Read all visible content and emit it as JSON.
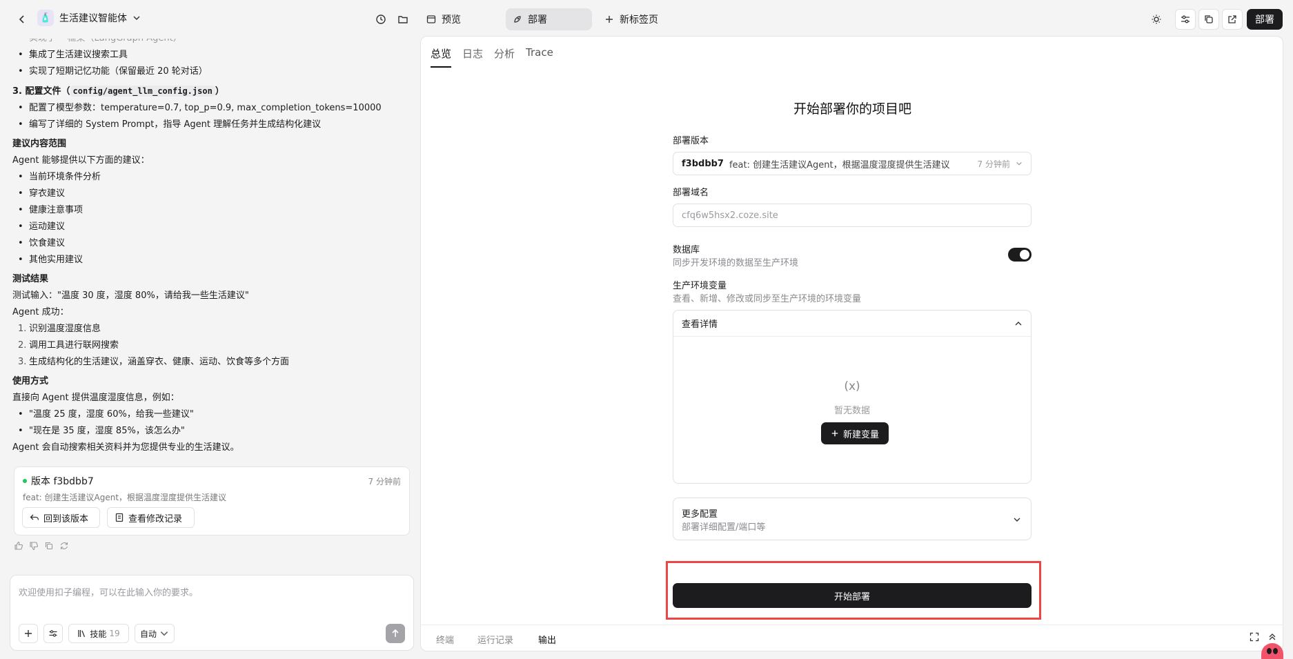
{
  "header": {
    "agent_name": "生活建议智能体",
    "tabs": [
      {
        "label": "预览"
      },
      {
        "label": "部署"
      },
      {
        "label": "新标签页"
      }
    ],
    "deploy_button": "部署"
  },
  "chat": {
    "clipped_line": "实现了 ·· 框架（LangGraph Agent）",
    "line_tools": "集成了生活建议搜索工具",
    "line_memory": "实现了短期记忆功能（保留最近 20 轮对话）",
    "config_heading_prefix": "3. 配置文件（",
    "config_path": "config/agent_llm_config.json",
    "config_heading_suffix": "）",
    "config_items": [
      "配置了模型参数：temperature=0.7, top_p=0.9, max_completion_tokens=10000",
      "编写了详细的 System Prompt，指导 Agent 理解任务并生成结构化建议"
    ],
    "scope_heading": "建议内容范围",
    "scope_intro": "Agent 能够提供以下方面的建议：",
    "scope_items": [
      "当前环境条件分析",
      "穿衣建议",
      "健康注意事项",
      "运动建议",
      "饮食建议",
      "其他实用建议"
    ],
    "test_heading": "测试结果",
    "test_input": "测试输入：\"温度 30 度，湿度 80%，请给我一些生活建议\"",
    "test_success": "Agent 成功：",
    "test_steps": [
      {
        "n": "1.",
        "text": "识别温度湿度信息"
      },
      {
        "n": "2.",
        "text": "调用工具进行联网搜索"
      },
      {
        "n": "3.",
        "text": "生成结构化的生活建议，涵盖穿衣、健康、运动、饮食等多个方面"
      }
    ],
    "usage_heading": "使用方式",
    "usage_intro": "直接向 Agent 提供温度湿度信息，例如：",
    "usage_examples": [
      "\"温度 25 度，湿度 60%，给我一些建议\"",
      "\"现在是 35 度，湿度 85%，该怎么办\""
    ],
    "usage_outro": "Agent 会自动搜索相关资料并为您提供专业的生活建议。"
  },
  "version_card": {
    "title": "版本 f3bdbb7",
    "time": "7 分钟前",
    "message": "feat: 创建生活建议Agent，根据温度湿度提供生活建议",
    "revert_label": "回到该版本",
    "log_label": "查看修改记录"
  },
  "input": {
    "placeholder": "欢迎使用扣子编程，可以在此输入你的要求。",
    "skill_label": "技能",
    "skill_count": "19",
    "mode_label": "自动"
  },
  "panel": {
    "tabs": [
      {
        "label": "总览"
      },
      {
        "label": "日志"
      },
      {
        "label": "分析"
      },
      {
        "label": "Trace"
      }
    ],
    "title": "开始部署你的项目吧",
    "version_label": "部署版本",
    "version_hash": "f3bdbb7",
    "version_message": "feat: 创建生活建议Agent，根据温度湿度提供生活建议",
    "version_time": "7 分钟前",
    "domain_label": "部署域名",
    "domain_value": "cfq6w5hsx2.coze.site",
    "db_label": "数据库",
    "db_sub": "同步开发环境的数据至生产环境",
    "env_label": "生产环境变量",
    "env_sub": "查看、新增、修改或同步至生产环境的环境变量",
    "env_details": "查看详情",
    "empty_icon": "(x)",
    "empty_text": "暂无数据",
    "new_var": "新建变量",
    "more_label": "更多配置",
    "more_sub": "部署详细配置/端口等",
    "start_button": "开始部署",
    "bottom_tabs": [
      {
        "label": "终端"
      },
      {
        "label": "运行记录"
      },
      {
        "label": "输出"
      }
    ]
  }
}
